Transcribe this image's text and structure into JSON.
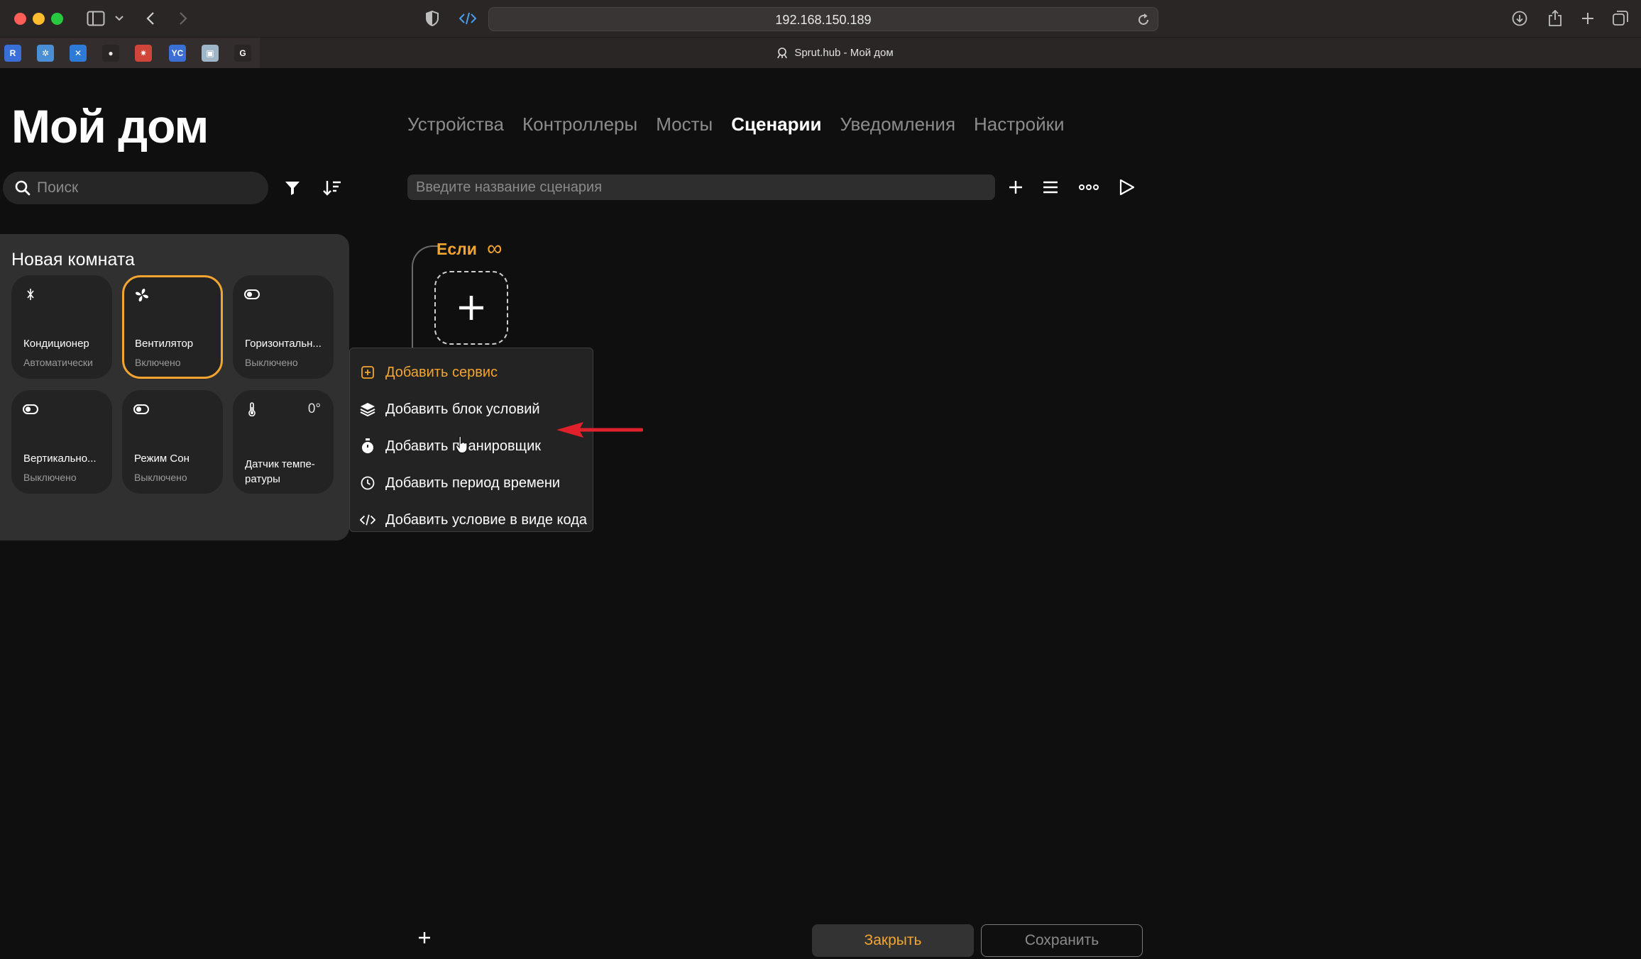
{
  "browser": {
    "url": "192.168.150.189",
    "tab_title": "Sprut.hub - Мой дом",
    "favicons": [
      {
        "name": "favicon-r",
        "letter": "R",
        "color": "#3a6fd8"
      },
      {
        "name": "favicon-star",
        "letter": "✲",
        "color": "#4a8fd6"
      },
      {
        "name": "favicon-vscode",
        "letter": "✕",
        "color": "#2d7bd6"
      },
      {
        "name": "favicon-github",
        "letter": "●",
        "color": "#e8e8e8"
      },
      {
        "name": "favicon-red",
        "letter": "✷",
        "color": "#d0453a"
      },
      {
        "name": "favicon-yc",
        "letter": "YC",
        "color": "#3b6fd4"
      },
      {
        "name": "favicon-grey",
        "letter": "▣",
        "color": "#9fb6c8"
      },
      {
        "name": "favicon-google",
        "letter": "G",
        "color": "#ffffff"
      }
    ]
  },
  "header": {
    "title": "Мой дом"
  },
  "nav": {
    "items": [
      "Устройства",
      "Контроллеры",
      "Мосты",
      "Сценарии",
      "Уведомления",
      "Настройки"
    ],
    "active": "Сценарии"
  },
  "search": {
    "placeholder": "Поиск"
  },
  "scenario": {
    "name_placeholder": "Введите название сценария",
    "if_label": "Если",
    "loop_symbol": "∞"
  },
  "room": {
    "title": "Новая комната",
    "tiles": [
      {
        "name": "Кондиционер",
        "status": "Автоматически",
        "icon": "air-conditioner-icon"
      },
      {
        "name": "Вентилятор",
        "status": "Включено",
        "icon": "fan-icon",
        "selected": true
      },
      {
        "name": "Горизонтальн...",
        "status": "Выключено",
        "icon": "toggle-icon"
      },
      {
        "name": "Вертикально...",
        "status": "Выключено",
        "icon": "toggle-icon"
      },
      {
        "name": "Режим Сон",
        "status": "Выключено",
        "icon": "toggle-icon"
      },
      {
        "name": "Датчик темпе-ратуры",
        "status": "",
        "value": "0°",
        "icon": "thermometer-icon"
      }
    ]
  },
  "menu": {
    "items": [
      {
        "label": "Добавить сервис",
        "icon": "plus-square-icon"
      },
      {
        "label": "Добавить блок условий",
        "icon": "layers-icon"
      },
      {
        "label": "Добавить планировщик",
        "icon": "stopwatch-icon"
      },
      {
        "label": "Добавить период времени",
        "icon": "clock-icon"
      },
      {
        "label": "Добавить условие в виде кода",
        "icon": "code-icon"
      }
    ]
  },
  "footer": {
    "close_label": "Закрыть",
    "save_label": "Сохранить"
  },
  "colors": {
    "accent": "#f4a530",
    "arrow": "#e0202a"
  }
}
